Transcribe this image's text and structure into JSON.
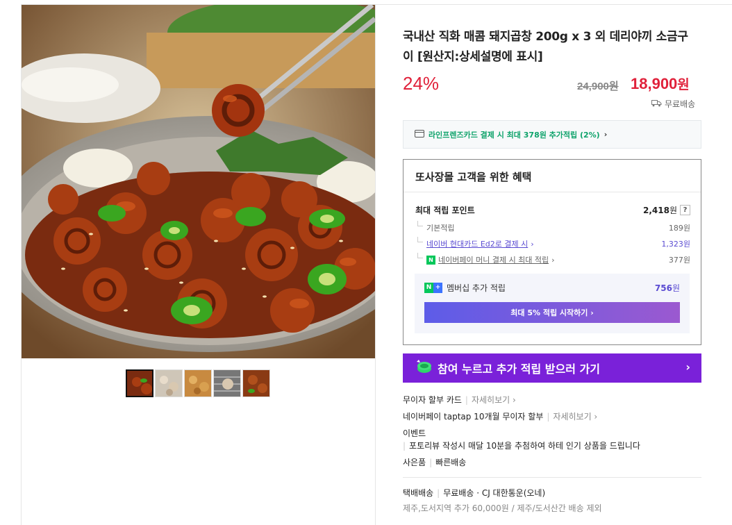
{
  "product": {
    "title": "국내산 직화 매콤 돼지곱창 200g x 3 외 데리야끼 소금구이 [원산지:상세설명에 표시]",
    "discount": "24%",
    "original_price": "24,900원",
    "price": "18,900",
    "price_unit": "원",
    "shipping": "무료배송"
  },
  "card_banner": {
    "text": "라인프렌즈카드 결제 시 최대 378원 추가적립 (2%)",
    "chevron": "›"
  },
  "benefit": {
    "title": "또사장몰 고객을 위한 혜택",
    "max_points_label": "최대 적립 포인트",
    "max_points_value": "2,418",
    "max_points_unit": "원",
    "help": "?",
    "rows": [
      {
        "label": "기본적립",
        "value": "189원"
      },
      {
        "label": "네이버 현대카드 Ed2로 결제 시",
        "value": "1,323원"
      },
      {
        "label": "네이버페이 머니 결제 시 최대 적립",
        "value": "377원"
      }
    ],
    "npay_badge": "N",
    "membership_badge_n": "N",
    "membership_badge_plus": "+",
    "membership_label": "멤버십 추가 적립",
    "membership_value": "756",
    "membership_unit": "원",
    "membership_button": "최대 5% 적립 시작하기 ›"
  },
  "cta": {
    "label": "참여 누르고 추가 적립 받으러 가기",
    "chevron": "›"
  },
  "extra_info": {
    "installment": "무이자 할부 카드",
    "installment_link": "자세히보기 ›",
    "naverpay_installment": "네이버페이 taptap 10개월 무이자 할부",
    "naverpay_link": "자세히보기 ›",
    "event_title": "이벤트",
    "event_text": "포토리뷰 작성시 매달 10분을 추첨하여 하테 인기 상품을 드립니다",
    "gift": "사은품",
    "gift_value": "빠른배송",
    "delivery_type": "택배배송",
    "delivery_info": "무료배송 · CJ 대한통운(오네)",
    "delivery_extra": "제주,도서지역 추가 60,000원 / 제주/도서산간 배송 제외"
  },
  "icons": {
    "card": "credit-card-icon",
    "truck": "truck-icon",
    "chevron": "chevron-right-icon",
    "coin": "coin-icon"
  },
  "colors": {
    "discount_red": "#e0213a",
    "naver_green": "#03c75a",
    "purple_cta": "#7a21d9",
    "member_purple": "#5a4bd2"
  }
}
